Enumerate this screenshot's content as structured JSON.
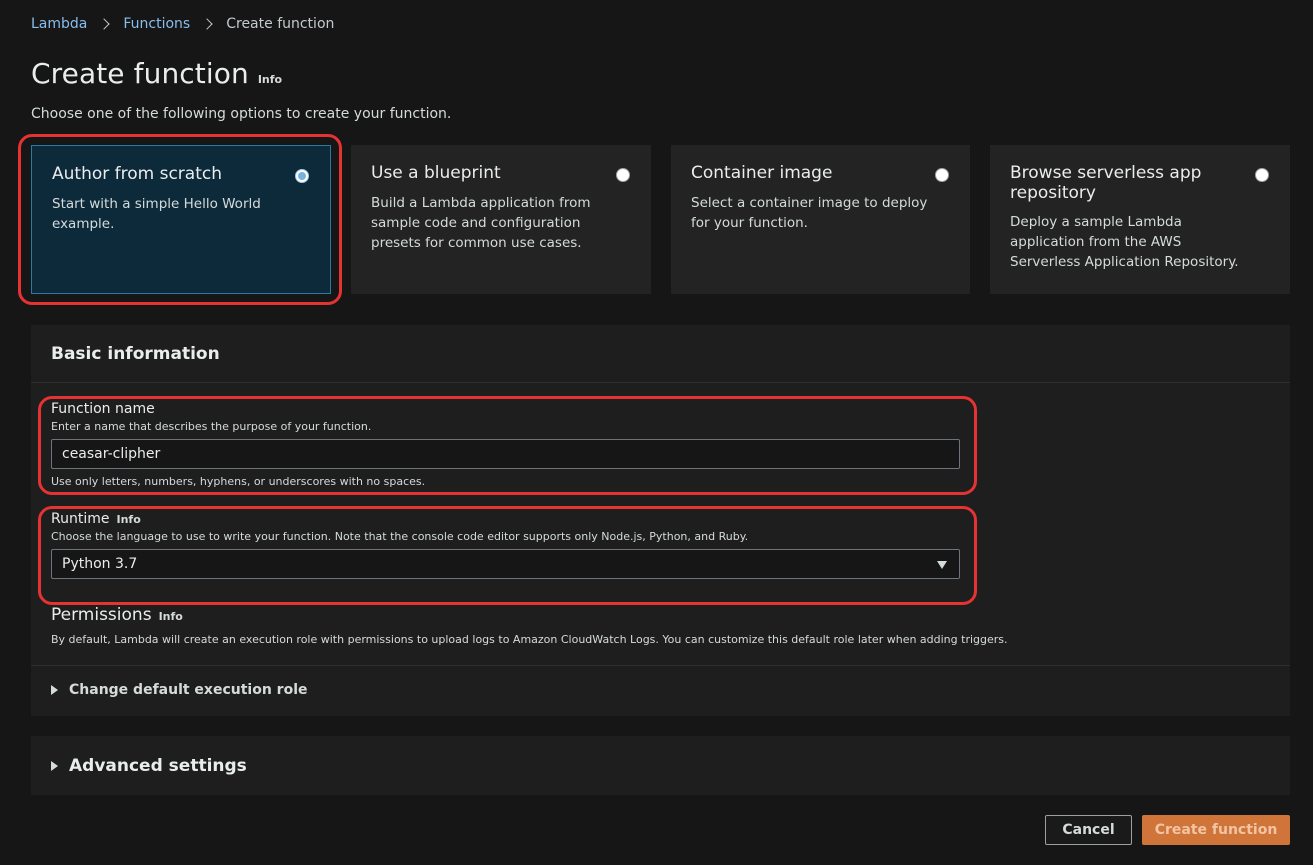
{
  "breadcrumb": {
    "items": [
      {
        "label": "Lambda"
      },
      {
        "label": "Functions"
      },
      {
        "label": "Create function"
      }
    ]
  },
  "page": {
    "title": "Create function",
    "title_info": "Info",
    "subtitle": "Choose one of the following options to create your function."
  },
  "options": [
    {
      "title": "Author from scratch",
      "description": "Start with a simple Hello World example.",
      "selected": true
    },
    {
      "title": "Use a blueprint",
      "description": "Build a Lambda application from sample code and configuration presets for common use cases.",
      "selected": false
    },
    {
      "title": "Container image",
      "description": "Select a container image to deploy for your function.",
      "selected": false
    },
    {
      "title": "Browse serverless app repository",
      "description": "Deploy a sample Lambda application from the AWS Serverless Application Repository.",
      "selected": false
    }
  ],
  "basic_info": {
    "header": "Basic information",
    "function_name": {
      "label": "Function name",
      "description": "Enter a name that describes the purpose of your function.",
      "value": "ceasar-clipher",
      "hint": "Use only letters, numbers, hyphens, or underscores with no spaces."
    },
    "runtime": {
      "label": "Runtime",
      "info": "Info",
      "description": "Choose the language to use to write your function. Note that the console code editor supports only Node.js, Python, and Ruby.",
      "value": "Python 3.7"
    },
    "permissions": {
      "label": "Permissions",
      "info": "Info",
      "description": "By default, Lambda will create an execution role with permissions to upload logs to Amazon CloudWatch Logs. You can customize this default role later when adding triggers."
    },
    "execution_role_label": "Change default execution role"
  },
  "advanced": {
    "label": "Advanced settings"
  },
  "buttons": {
    "cancel": "Cancel",
    "create": "Create function"
  },
  "colors": {
    "highlight": "#e53232",
    "link": "#89bdee",
    "primary_button": "#d0753a",
    "selected_tile": "#0d2a3a"
  }
}
